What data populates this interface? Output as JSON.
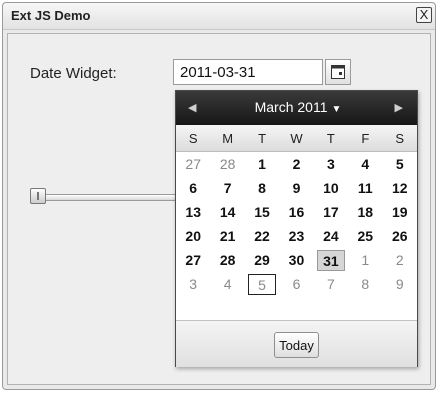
{
  "window": {
    "title": "Ext JS Demo",
    "close_glyph": "X"
  },
  "form": {
    "date_label": "Date Widget:",
    "date_value": "2011-03-31"
  },
  "slider": {
    "value_fraction": 0.0
  },
  "datepicker": {
    "month_label": "March 2011",
    "caret": "▼",
    "prev": "◀",
    "next": "▶",
    "weekdays": [
      "S",
      "M",
      "T",
      "W",
      "T",
      "F",
      "S"
    ],
    "weeks": [
      [
        {
          "d": "27",
          "o": true
        },
        {
          "d": "28",
          "o": true
        },
        {
          "d": "1"
        },
        {
          "d": "2"
        },
        {
          "d": "3"
        },
        {
          "d": "4"
        },
        {
          "d": "5"
        }
      ],
      [
        {
          "d": "6"
        },
        {
          "d": "7"
        },
        {
          "d": "8"
        },
        {
          "d": "9"
        },
        {
          "d": "10"
        },
        {
          "d": "11"
        },
        {
          "d": "12"
        }
      ],
      [
        {
          "d": "13"
        },
        {
          "d": "14"
        },
        {
          "d": "15"
        },
        {
          "d": "16"
        },
        {
          "d": "17"
        },
        {
          "d": "18"
        },
        {
          "d": "19"
        }
      ],
      [
        {
          "d": "20"
        },
        {
          "d": "21"
        },
        {
          "d": "22"
        },
        {
          "d": "23"
        },
        {
          "d": "24"
        },
        {
          "d": "25"
        },
        {
          "d": "26"
        }
      ],
      [
        {
          "d": "27"
        },
        {
          "d": "28"
        },
        {
          "d": "29"
        },
        {
          "d": "30"
        },
        {
          "d": "31",
          "sel": true
        },
        {
          "d": "1",
          "o": true
        },
        {
          "d": "2",
          "o": true
        }
      ],
      [
        {
          "d": "3",
          "o": true
        },
        {
          "d": "4",
          "o": true
        },
        {
          "d": "5",
          "o": true,
          "today": true
        },
        {
          "d": "6",
          "o": true
        },
        {
          "d": "7",
          "o": true
        },
        {
          "d": "8",
          "o": true
        },
        {
          "d": "9",
          "o": true
        }
      ]
    ],
    "today_label": "Today"
  }
}
